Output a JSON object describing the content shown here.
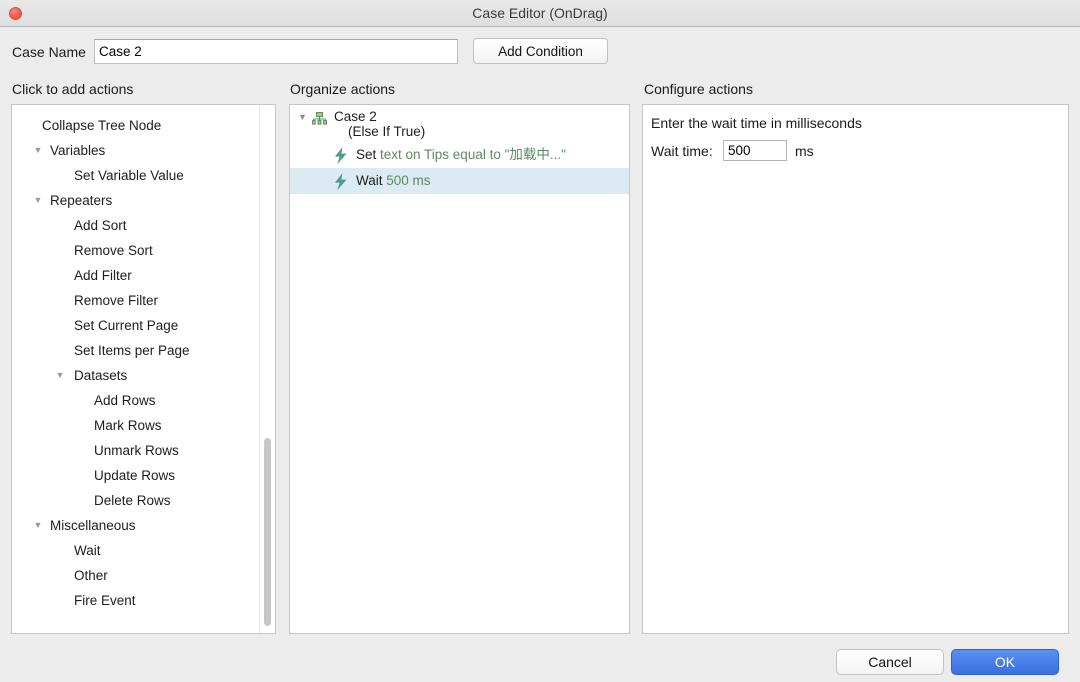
{
  "window": {
    "title": "Case Editor (OnDrag)",
    "close_icon": "close-icon"
  },
  "toolbar": {
    "case_name_label": "Case Name",
    "case_name_value": "Case 2",
    "case_name_placeholder": "",
    "add_condition_label": "Add Condition"
  },
  "columns": {
    "left_header": "Click to add actions",
    "middle_header": "Organize actions",
    "right_header": "Configure actions"
  },
  "actions_tree": [
    {
      "label": "Collapse Tree Node",
      "level": 0,
      "twisty": ""
    },
    {
      "label": "Variables",
      "level": 1,
      "twisty": "▼"
    },
    {
      "label": "Set Variable Value",
      "level": 2,
      "twisty": ""
    },
    {
      "label": "Repeaters",
      "level": 1,
      "twisty": "▼"
    },
    {
      "label": "Add Sort",
      "level": 2,
      "twisty": ""
    },
    {
      "label": "Remove Sort",
      "level": 2,
      "twisty": ""
    },
    {
      "label": "Add Filter",
      "level": 2,
      "twisty": ""
    },
    {
      "label": "Remove Filter",
      "level": 2,
      "twisty": ""
    },
    {
      "label": "Set Current Page",
      "level": 2,
      "twisty": ""
    },
    {
      "label": "Set Items per Page",
      "level": 2,
      "twisty": ""
    },
    {
      "label": "Datasets",
      "level": 2,
      "twisty": "▼"
    },
    {
      "label": "Add Rows",
      "level": 3,
      "twisty": ""
    },
    {
      "label": "Mark Rows",
      "level": 3,
      "twisty": ""
    },
    {
      "label": "Unmark Rows",
      "level": 3,
      "twisty": ""
    },
    {
      "label": "Update Rows",
      "level": 3,
      "twisty": ""
    },
    {
      "label": "Delete Rows",
      "level": 3,
      "twisty": ""
    },
    {
      "label": "Miscellaneous",
      "level": 1,
      "twisty": "▼"
    },
    {
      "label": "Wait",
      "level": 2,
      "twisty": ""
    },
    {
      "label": "Other",
      "level": 2,
      "twisty": ""
    },
    {
      "label": "Fire Event",
      "level": 2,
      "twisty": ""
    }
  ],
  "organize": {
    "case_twisty": "▼",
    "case_icon": "case-node-icon",
    "case_title": "Case 2",
    "case_subtitle": "(Else If True)",
    "items": [
      {
        "icon": "lightning-bolt-icon",
        "verb": "Set ",
        "argument": "text on Tips equal to \"加载中...\"",
        "selected": false
      },
      {
        "icon": "lightning-bolt-icon",
        "verb": "Wait ",
        "argument": "500 ms",
        "selected": true
      }
    ]
  },
  "configure": {
    "description": "Enter the wait time in milliseconds",
    "wait_label": "Wait time:",
    "wait_value": "500",
    "wait_placeholder": "",
    "unit": "ms"
  },
  "footer": {
    "cancel_label": "Cancel",
    "ok_label": "OK"
  },
  "colors": {
    "window_background": "#ececec",
    "panel_background": "#ffffff",
    "selection": "#dceaf4",
    "action_argument": "#5c8a62",
    "bolt_icon": "#4f9c8b",
    "ok_button": "#3a6fe0",
    "close_button": "#f45a4e"
  }
}
